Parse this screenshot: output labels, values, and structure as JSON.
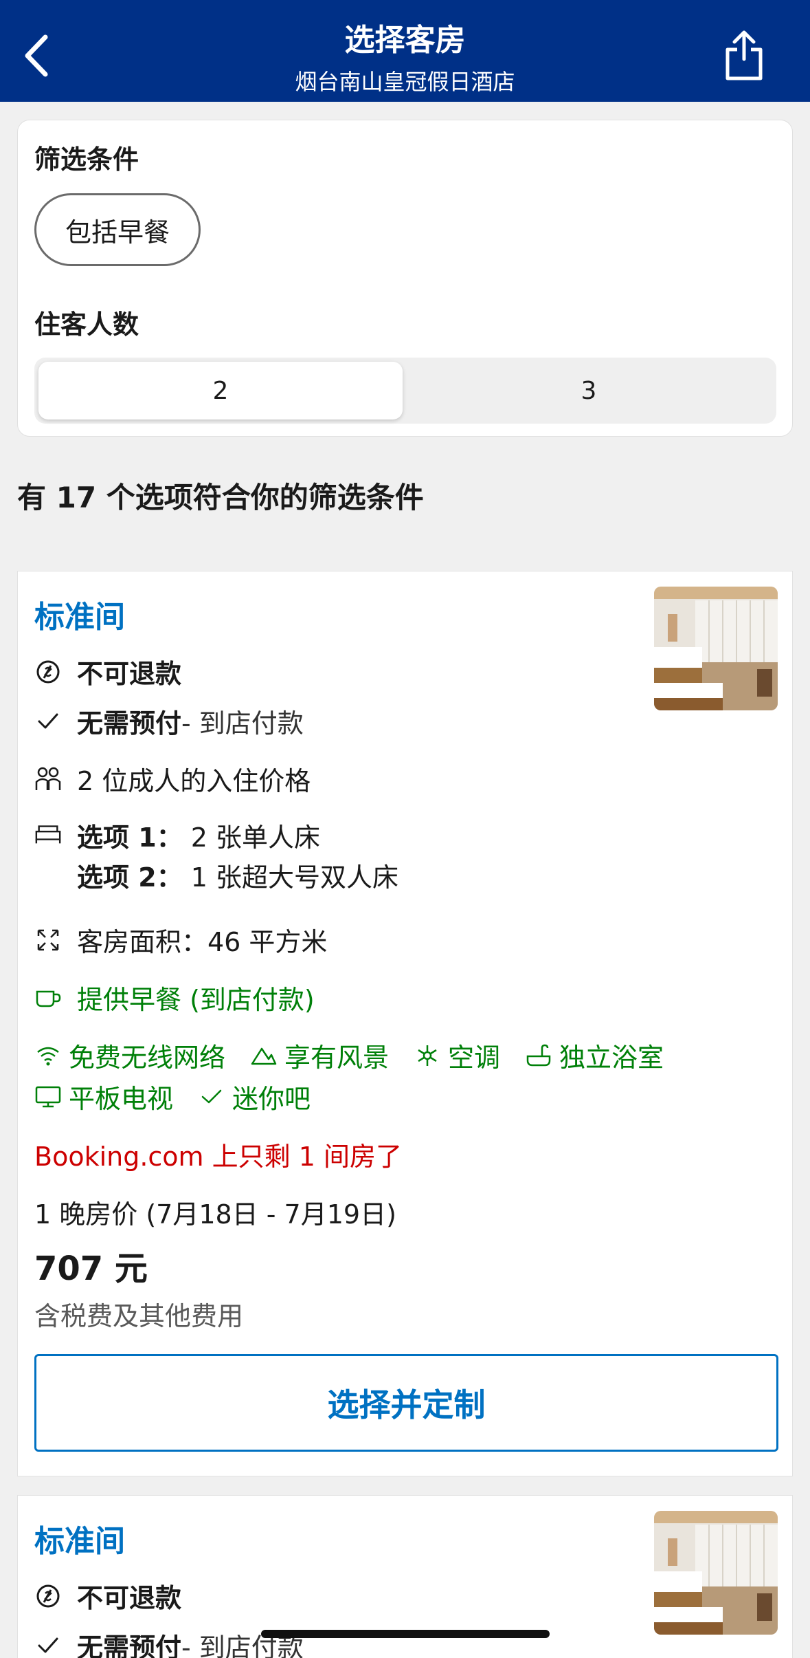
{
  "header": {
    "title": "选择客房",
    "subtitle": "烟台南山皇冠假日酒店",
    "back_icon": "chevron-left-icon",
    "share_icon": "share-icon"
  },
  "filters": {
    "section_label": "筛选条件",
    "chip_breakfast": "包括早餐",
    "guests_label": "住客人数",
    "guest_options": [
      "2",
      "3"
    ],
    "guest_selected": "2"
  },
  "results": {
    "count_text": "有 17 个选项符合你的筛选条件"
  },
  "rooms": [
    {
      "name": "标准间",
      "refund": "不可退款",
      "prepay_bold": "无需预付",
      "prepay_rest": " - 到店付款",
      "occupancy": "2 位成人的入住价格",
      "bed_option1_label": "选项 1：",
      "bed_option1_value": "2 张单人床",
      "bed_option2_label": "选项 2：",
      "bed_option2_value": "1 张超大号双人床",
      "area": "客房面积：46 平方米",
      "breakfast": "提供早餐 (到店付款)",
      "amenities": [
        "免费无线网络",
        "享有风景",
        "空调",
        "独立浴室",
        "平板电视",
        "迷你吧"
      ],
      "scarcity": "Booking.com 上只剩 1 间房了",
      "nights": "1 晚房价 (7月18日 - 7月19日)",
      "price": "707 元",
      "tax_note": "含税费及其他费用",
      "cta": "选择并定制"
    },
    {
      "name": "标准间",
      "refund": "不可退款",
      "prepay_bold": "无需预付",
      "prepay_rest": " - 到店付款"
    }
  ],
  "colors": {
    "header_bg": "#003087",
    "link_blue": "#0071c2",
    "green": "#008009",
    "red": "#cc0000"
  }
}
